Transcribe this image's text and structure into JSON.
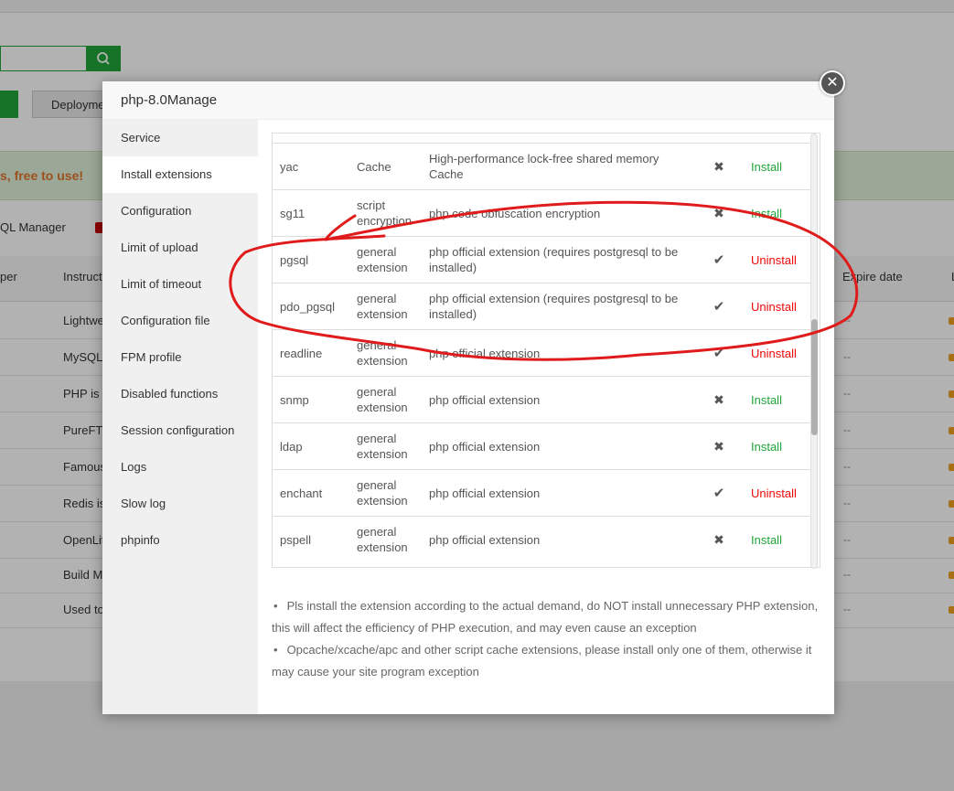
{
  "background": {
    "deploy_label": "Deployme",
    "banner_text": "s, free to use!",
    "sql_manager": "QL Manager",
    "columns": {
      "per": "per",
      "instruct": "Instruct",
      "expire": "Expire date",
      "l": "L"
    },
    "rows": [
      {
        "text": "Lightwe",
        "expire": "--"
      },
      {
        "text": "MySQL",
        "expire": "--"
      },
      {
        "text": "PHP is t",
        "expire": "--"
      },
      {
        "text": "PureFTP",
        "expire": "--"
      },
      {
        "text": "Famous",
        "expire": "--"
      },
      {
        "text": "Redis is",
        "expire": "--"
      },
      {
        "text": "OpenLit",
        "expire": "--"
      },
      {
        "text": "Build M",
        "expire": "--"
      },
      {
        "text": "Used to",
        "expire": "--"
      }
    ]
  },
  "modal": {
    "title": "php-8.0Manage",
    "close_icon": "close-icon",
    "sidebar": [
      {
        "label": "Service",
        "active": false
      },
      {
        "label": "Install extensions",
        "active": true
      },
      {
        "label": "Configuration",
        "active": false
      },
      {
        "label": "Limit of upload",
        "active": false
      },
      {
        "label": "Limit of timeout",
        "active": false
      },
      {
        "label": "Configuration file",
        "active": false
      },
      {
        "label": "FPM profile",
        "active": false
      },
      {
        "label": "Disabled functions",
        "active": false
      },
      {
        "label": "Session configuration",
        "active": false
      },
      {
        "label": "Logs",
        "active": false
      },
      {
        "label": "Slow log",
        "active": false
      },
      {
        "label": "phpinfo",
        "active": false
      }
    ],
    "extensions": [
      {
        "name": "yac",
        "type": "Cache",
        "desc": "High-performance lock-free shared memory Cache",
        "installed": false,
        "action": "Install"
      },
      {
        "name": "sg11",
        "type": "script encryption",
        "desc": "php code obfuscation encryption",
        "installed": false,
        "action": "Install"
      },
      {
        "name": "pgsql",
        "type": "general extension",
        "desc": "php official extension (requires postgresql to be installed)",
        "installed": true,
        "action": "Uninstall"
      },
      {
        "name": "pdo_pgsql",
        "type": "general extension",
        "desc": "php official extension (requires postgresql to be installed)",
        "installed": true,
        "action": "Uninstall"
      },
      {
        "name": "readline",
        "type": "general extension",
        "desc": "php official extension",
        "installed": true,
        "action": "Uninstall"
      },
      {
        "name": "snmp",
        "type": "general extension",
        "desc": "php official extension",
        "installed": false,
        "action": "Install"
      },
      {
        "name": "ldap",
        "type": "general extension",
        "desc": "php official extension",
        "installed": false,
        "action": "Install"
      },
      {
        "name": "enchant",
        "type": "general extension",
        "desc": "php official extension",
        "installed": true,
        "action": "Uninstall"
      },
      {
        "name": "pspell",
        "type": "general extension",
        "desc": "php official extension",
        "installed": false,
        "action": "Install"
      }
    ],
    "tips": [
      "Pls install the extension according to the actual demand, do NOT install unnecessary PHP extension, this will affect the efficiency of PHP execution, and may even cause an exception",
      "Opcache/xcache/apc and other script cache extensions, please install only one of them, otherwise it may cause your site program exception"
    ]
  },
  "colors": {
    "install": "#20a53a",
    "uninstall": "#ef0808",
    "annotation": "#e01b1b"
  }
}
